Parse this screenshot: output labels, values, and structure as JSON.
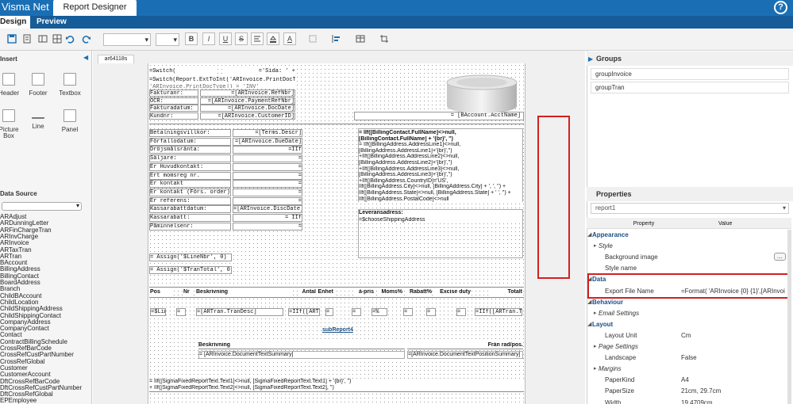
{
  "app": {
    "title": "Visma Net",
    "tab": "Report Designer"
  },
  "subtabs": {
    "design": "Design",
    "preview": "Preview"
  },
  "toolbar": {
    "bold": "B",
    "italic": "I",
    "underline": "U",
    "strike": "S",
    "font_color": "A"
  },
  "insert": {
    "title": "Insert",
    "items": [
      "Header",
      "Footer",
      "Textbox",
      "Picture Box",
      "Line",
      "Panel"
    ]
  },
  "datasource": {
    "title": "Data Source",
    "items": [
      "ARAdjust",
      "ARDunningLetter",
      "ARFinChargeTran",
      "ARInvCharge",
      "ARInvoice",
      "ARTaxTran",
      "ARTran",
      "BAccount",
      "BillingAddress",
      "BillingContact",
      "BoardAddress",
      "Branch",
      "ChildBAccount",
      "ChildLocation",
      "ChildShippingAddress",
      "ChildShippingContact",
      "CompanyAddress",
      "CompanyContact",
      "Contact",
      "ContractBillingSchedule",
      "CrossRefBarCode",
      "CrossRefCustPartNumber",
      "CrossRefGlobal",
      "Customer",
      "CustomerAccount",
      "DftCrossRefBarCode",
      "DftCrossRefCustPartNumber",
      "DftCrossRefGlobal",
      "EPEmployee"
    ]
  },
  "doc": {
    "tab": "ar64118s"
  },
  "report": {
    "switch1": "=Switch(",
    "sida": "='Sida: ' +",
    "switch2": "=Switch(Report.ExtToInt('ARInvoice.PrintDocType",
    "switch3": "'ARInvoice.PrintDocType]) = 'INV'",
    "rows1": [
      {
        "label": "Fakturanr:",
        "value": "=[ARInvoice.RefNbr]"
      },
      {
        "label": "OCR:",
        "value": "=[ARInvoice.PaymentRefNbr]"
      },
      {
        "label": "Fakturadatum:",
        "value": "=[ARInvoice.DocDate]"
      },
      {
        "label": "Kundnr:",
        "value": "=[ARInvoice.CustomerID]"
      }
    ],
    "acct": "= [BAccount.AcctName]",
    "rows2": [
      {
        "label": "Betalningsvillkor:",
        "value": "=[Terms.Descr]"
      },
      {
        "label": "Förfallodatum:",
        "value": "=[ARInvoice.DueDate]"
      },
      {
        "label": "Dröjsmålsränta:",
        "value": "=IIf"
      },
      {
        "label": "Säljare:",
        "value": "="
      },
      {
        "label": "Er Huvudkontakt:",
        "value": "="
      },
      {
        "label": "Ert momsreg nr.",
        "value": "="
      },
      {
        "label": "Er kontakt",
        "value": "="
      },
      {
        "label": "Er kontakt (Förs. order):",
        "value": "="
      },
      {
        "label": "Er referens:",
        "value": "="
      },
      {
        "label": "Kassarabattdatum:",
        "value": "=[ARInvoice.DiscDate]"
      },
      {
        "label": "Kassarabatt:",
        "value": "= IIf"
      },
      {
        "label": "Påminnelsenr:",
        "value": "="
      }
    ],
    "billing": [
      "= IIf([BillingContact.FullName]<>null,",
      "[BillingContact.FullName] + '{br}', '')",
      "= IIf([BillingAddress.AddressLine1]<>null,",
      "[BillingAddress.AddressLine1]+'{br}','')",
      "+IIf([BillingAddress.AddressLine2]<>null,",
      "[BillingAddress.AddressLine2]+'{br}','')",
      "+IIf([BillingAddress.AddressLine3]<>null,",
      "[BillingAddress.AddressLine3]+'{br}','')",
      "+IIf([BillingAddress.CountryID]='US',",
      "   IIf([BillingAddress.City]<>null, [BillingAddress.City] + ', ', '') +",
      "IIf([BillingAddress.State]<>null, [BillingAddress.State] + ' ', '') +",
      "IIf([BillingAddress.PostalCode]<>null"
    ],
    "leverans_label": "Leveransadress:",
    "leverans_value": "=$chooseShippingAddress",
    "assign1": "= Assign('$LineNbr', 0)",
    "assign2": "= Assign('$TranTotal', 0)",
    "columns": [
      "Pos",
      "Nr",
      "Beskrivning",
      "Antal",
      "Enhet",
      "à-pris",
      "Moms%",
      "Rabatt%",
      "Excise duty",
      "Totalt"
    ],
    "detail": {
      "lin": "=$Lin",
      "eq1": "=",
      "desc": "=[ARTran.TranDesc]",
      "iif": "=IIf([ARTr",
      "eq2": "=",
      "eq3": "=",
      "pct": "=%",
      "eq4": "=",
      "eq5": "=",
      "eq6": "=",
      "total": "=IIf([ARTran.TranT"
    },
    "subreport": "subReport4",
    "sub_desc_label": "Beskrivning",
    "sub_pos_label": "Från rad/pos.",
    "sub_desc_value": "= [ARInvoice.DocumentTextSummary]",
    "sub_pos_value": "=[ARInvoice.DocumentTextPositionSummary]",
    "sigma1": "= IIf([SigmaFixedReportText.Text1]<>null, [SigmaFixedReportText.Text1] + '{br}', '')",
    "sigma2": "+ IIf([SigmaFixedReportText.Text2]<>null, [SigmaFixedReportText.Text2], '')"
  },
  "groups": {
    "title": "Groups",
    "items": [
      "groupInvoice",
      "groupTran"
    ]
  },
  "properties": {
    "title": "Properties",
    "object": "report1",
    "col_property": "Property",
    "col_value": "Value",
    "rows": [
      {
        "kind": "sec",
        "name": "Appearance",
        "value": ""
      },
      {
        "kind": "sub",
        "name": "Style",
        "value": ""
      },
      {
        "kind": "item",
        "name": "Background image",
        "value": "..."
      },
      {
        "kind": "item",
        "name": "Style name",
        "value": ""
      },
      {
        "kind": "sec",
        "name": "Data",
        "value": ""
      },
      {
        "kind": "item",
        "name": "Export File Name",
        "value": "=Format( 'ARInvoice {0} {1}',[ARInvoi"
      },
      {
        "kind": "sec",
        "name": "Behaviour",
        "value": ""
      },
      {
        "kind": "sub",
        "name": "Email Settings",
        "value": ""
      },
      {
        "kind": "sec",
        "name": "Layout",
        "value": ""
      },
      {
        "kind": "item",
        "name": "Layout Unit",
        "value": "Cm"
      },
      {
        "kind": "sub",
        "name": "Page Settings",
        "value": ""
      },
      {
        "kind": "item",
        "name": "Landscape",
        "value": "False"
      },
      {
        "kind": "sub",
        "name": "Margins",
        "value": ""
      },
      {
        "kind": "item",
        "name": "PaperKind",
        "value": "A4"
      },
      {
        "kind": "item",
        "name": "PaperSize",
        "value": "21cm, 29.7cm"
      },
      {
        "kind": "item",
        "name": "Width",
        "value": "19.4709cm"
      }
    ]
  },
  "colors": {
    "topbar": "#1a6fb4",
    "subtabs": "#165c99",
    "highlight": "#d32020",
    "section": "#1a4f86"
  }
}
